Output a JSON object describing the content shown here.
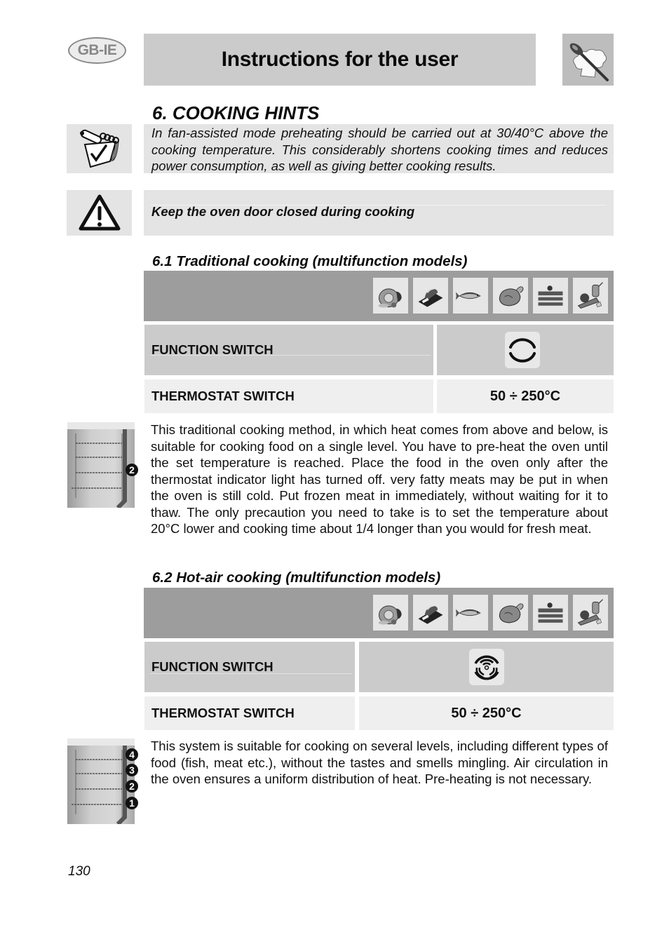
{
  "header": {
    "region_badge": "GB-IE",
    "title": "Instructions for the user",
    "logo_icon": "chef-hat-spoon-icon"
  },
  "section": {
    "title": "6.  COOKING HINTS",
    "note": {
      "icon": "notepad-check-icon",
      "text": "In fan-assisted mode preheating should be carried out at 30/40°C above the cooking temperature. This considerably shortens cooking times and reduces power consumption, as well as giving better cooking results."
    },
    "warning": {
      "icon": "warning-triangle-icon",
      "text": "Keep the oven door closed during cooking"
    }
  },
  "food_icons": [
    "roast-meat-icon",
    "bread-icon",
    "fish-icon",
    "poultry-icon",
    "cake-icon",
    "vegetables-icon"
  ],
  "subsections": [
    {
      "title": "6.1 Traditional cooking (multifunction models)",
      "function_switch_label": "FUNCTION SWITCH",
      "function_switch_icon": "top-bottom-heat-icon",
      "thermostat_label": "THERMOSTAT SWITCH",
      "thermostat_value": "50 ÷ 250°C",
      "shelf_levels": [
        "2"
      ],
      "description": "This traditional cooking method, in which heat comes from above and below, is suitable for cooking food on a single level. You have to pre-heat the oven until the set temperature is reached. Place the food in the oven only after the thermostat indicator light has turned off. very fatty meats may be put in when the oven is still cold. Put frozen meat in immediately, without waiting for it to thaw. The only precaution you need to take is to set the temperature about 20°C lower and cooking time about 1/4 longer than you would for fresh meat."
    },
    {
      "title": "6.2 Hot-air cooking (multifunction models)",
      "function_switch_label": "FUNCTION SWITCH",
      "function_switch_icon": "fan-circular-heat-icon",
      "thermostat_label": "THERMOSTAT SWITCH",
      "thermostat_value": "50 ÷ 250°C",
      "shelf_levels": [
        "4",
        "3",
        "2",
        "1"
      ],
      "description": "This system is suitable for cooking on several levels, including different types of food (fish, meat etc.), without the tastes and smells mingling. Air circulation in the oven ensures a uniform distribution of heat. Pre-heating is not necessary."
    }
  ],
  "footer": {
    "page_number": "130"
  }
}
